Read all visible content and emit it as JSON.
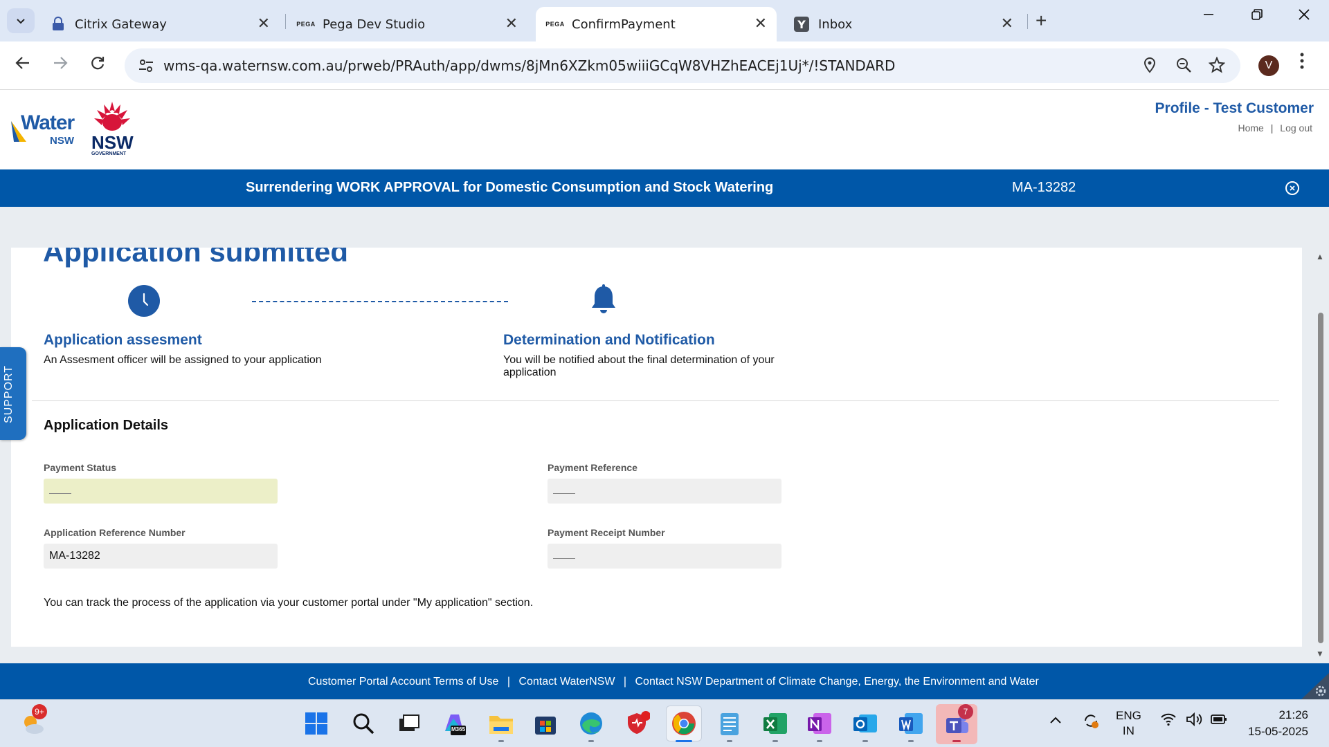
{
  "browser": {
    "tabs": [
      {
        "title": "Citrix Gateway",
        "favicon": "citrix-lock-icon"
      },
      {
        "title": "Pega Dev Studio",
        "favicon": "pega-icon"
      },
      {
        "title": "ConfirmPayment",
        "favicon": "pega-icon",
        "active": true
      },
      {
        "title": "Inbox",
        "favicon": "yahoo-mail-icon"
      }
    ],
    "pega_label": "PEGA",
    "url": "wms-qa.waternsw.com.au/prweb/PRAuth/app/dwms/8jMn6XZkm05wiiiGCqW8VHZhEACEj1Uj*/!STANDARD",
    "profile_initial": "V"
  },
  "header": {
    "logo_water": "Water",
    "logo_water_sub": "NSW",
    "logo_nsw": "NSW",
    "logo_nsw_sub": "GOVERNMENT",
    "profile_title": "Profile - Test Customer",
    "links": [
      "Home",
      "Log out"
    ],
    "link_separator": "|"
  },
  "case_bar": {
    "title": "Surrendering WORK APPROVAL for Domestic Consumption and Stock Watering",
    "case_id": "MA-13282"
  },
  "main": {
    "page_title": "Application submitted",
    "steps": [
      {
        "title": "Application assesment",
        "description": "An Assesment officer will be assigned to your application",
        "icon": "clock-icon"
      },
      {
        "title": "Determination and Notification",
        "description": "You will be notified about the final determination of your application",
        "icon": "bell-icon"
      }
    ],
    "section_title": "Application Details",
    "fields": {
      "payment_status": {
        "label": "Payment Status",
        "value": ""
      },
      "payment_reference": {
        "label": "Payment Reference",
        "value": ""
      },
      "application_reference_number": {
        "label": "Application Reference Number",
        "value": "MA-13282"
      },
      "payment_receipt_number": {
        "label": "Payment Receipt Number",
        "value": ""
      }
    },
    "tracking_note": "You can track the process of the application via your customer portal under \"My application\" section.",
    "support_label": "SUPPORT"
  },
  "footer": {
    "links": [
      "Customer Portal Account Terms of Use",
      "Contact WaterNSW",
      "Contact NSW Department of Climate Change, Energy, the Environment and Water"
    ],
    "separator": "|"
  },
  "taskbar": {
    "weather_badge": "9+",
    "m365_label": "M365",
    "teams_badge": "7",
    "language": "ENG",
    "region": "IN",
    "time": "21:26",
    "date": "15-05-2025"
  },
  "colors": {
    "brand_blue": "#0057a8",
    "heading_blue": "#1f5aa6",
    "payment_status_bg": "#ecefc8"
  }
}
